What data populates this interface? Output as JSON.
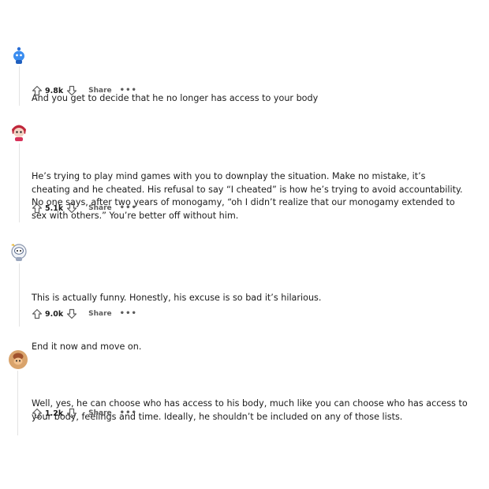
{
  "comments": [
    {
      "avatar_icon": "blue-snoo-avatar-icon",
      "body": [
        "And you get to decide that he no longer has access to your body"
      ],
      "score": "9.8k",
      "share_label": "Share",
      "more_label": "•••"
    },
    {
      "avatar_icon": "red-hair-snoo-avatar-icon",
      "body": [
        "He’s trying to play mind games with you to downplay the situation. Make no mistake, it’s\ncheating and he cheated. His refusal to say “I cheated” is how he’s trying to avoid accountability.\nNo one says, after two years of monogamy, “oh I didn’t realize that our monogamy extended to\nsex with others.” You’re better off without him."
      ],
      "score": "5.1k",
      "share_label": "Share",
      "more_label": "•••"
    },
    {
      "avatar_icon": "astronaut-snoo-avatar-icon",
      "body": [
        "This is actually funny. Honestly, his excuse is so bad it’s hilarious.",
        "End it now and move on."
      ],
      "score": "9.0k",
      "share_label": "Share",
      "more_label": "•••"
    },
    {
      "avatar_icon": "brown-snoo-avatar-icon",
      "body": [
        "Well, yes, he can choose who has access to his body, much like you can choose who has access to\nyour body, feelings and time. Ideally, he shouldn’t be included on any of those lists."
      ],
      "score": "1.2k",
      "share_label": "Share",
      "more_label": "•••"
    }
  ]
}
